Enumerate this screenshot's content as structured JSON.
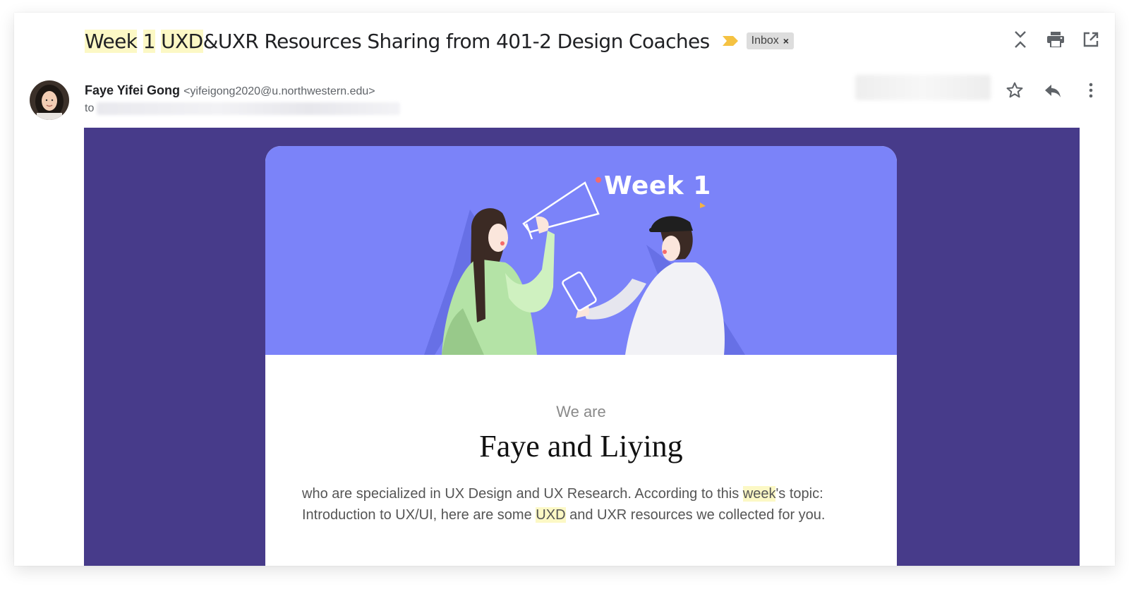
{
  "subject": {
    "parts": [
      {
        "text": "Week",
        "highlight": true
      },
      {
        "text": " ",
        "highlight": false
      },
      {
        "text": "1",
        "highlight": true
      },
      {
        "text": " ",
        "highlight": false
      },
      {
        "text": "UXD",
        "highlight": true
      },
      {
        "text": "&UXR Resources Sharing from 401-2 Design Coaches",
        "highlight": false
      }
    ],
    "label": "Inbox",
    "label_remove": "×",
    "important_marker_color": "#f5c242",
    "highlight_color": "#fcf8c5"
  },
  "toolbar": {
    "icons": [
      "collapse-all-icon",
      "print-icon",
      "open-in-new-window-icon"
    ]
  },
  "sender": {
    "name": "Faye Yifei Gong",
    "email": "<yifeigong2020@u.northwestern.edu>",
    "to_label": "to"
  },
  "message_actions": {
    "icons": [
      "star-icon",
      "reply-icon",
      "more-options-icon"
    ]
  },
  "email_body": {
    "background_color": "#473b8a",
    "hero_color": "#7b83f9",
    "hero_title": "Week 1",
    "we_are": "We are",
    "names": "Faye and Liying",
    "intro_parts": [
      {
        "text": "who are specialized in UX Design and UX Research. According to this ",
        "highlight": false
      },
      {
        "text": "week",
        "highlight": true
      },
      {
        "text": "'s topic: Introduction to UX/UI, here are some ",
        "highlight": false
      },
      {
        "text": "UXD",
        "highlight": true
      },
      {
        "text": " and UXR resources we collected for you.",
        "highlight": false
      }
    ]
  }
}
